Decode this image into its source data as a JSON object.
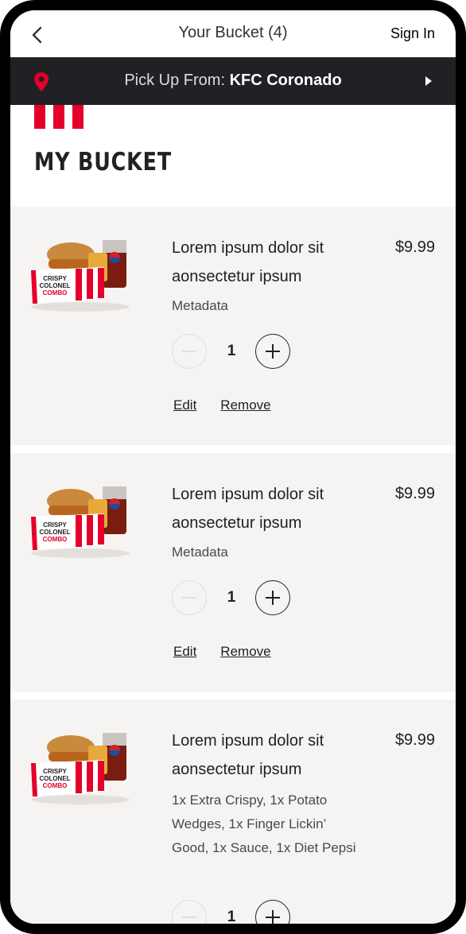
{
  "header": {
    "title": "Your Bucket (4)",
    "sign_in": "Sign In",
    "back_icon": "chevron-left-icon"
  },
  "pickup": {
    "label": "Pick Up From: ",
    "store": "KFC Coronado",
    "pin_icon": "location-pin-icon",
    "arrow_icon": "caret-right-icon",
    "pin_color": "#e4002b"
  },
  "section": {
    "title": "MY BUCKET"
  },
  "items": [
    {
      "name": "Lorem ipsum dolor sit aonsectetur ipsum",
      "price": "$9.99",
      "meta": "Metadata",
      "quantity": "1",
      "edit": "Edit",
      "remove": "Remove",
      "image_label_1": "CRISPY",
      "image_label_2": "COLONEL",
      "image_label_3": "COMBO"
    },
    {
      "name": "Lorem ipsum dolor sit aonsectetur ipsum",
      "price": "$9.99",
      "meta": "Metadata",
      "quantity": "1",
      "edit": "Edit",
      "remove": "Remove",
      "image_label_1": "CRISPY",
      "image_label_2": "COLONEL",
      "image_label_3": "COMBO"
    },
    {
      "name": "Lorem ipsum dolor sit aonsectetur ipsum",
      "price": "$9.99",
      "meta": "1x Extra Crispy, 1x Potato Wedges, 1x Finger Lickin’ Good, 1x Sauce, 1x Diet Pepsi",
      "quantity": "1",
      "image_label_1": "CRISPY",
      "image_label_2": "COLONEL",
      "image_label_3": "COMBO"
    }
  ],
  "colors": {
    "brand_red": "#e4002b",
    "dark_bar": "#202124",
    "card_bg": "#f6f4f2"
  }
}
